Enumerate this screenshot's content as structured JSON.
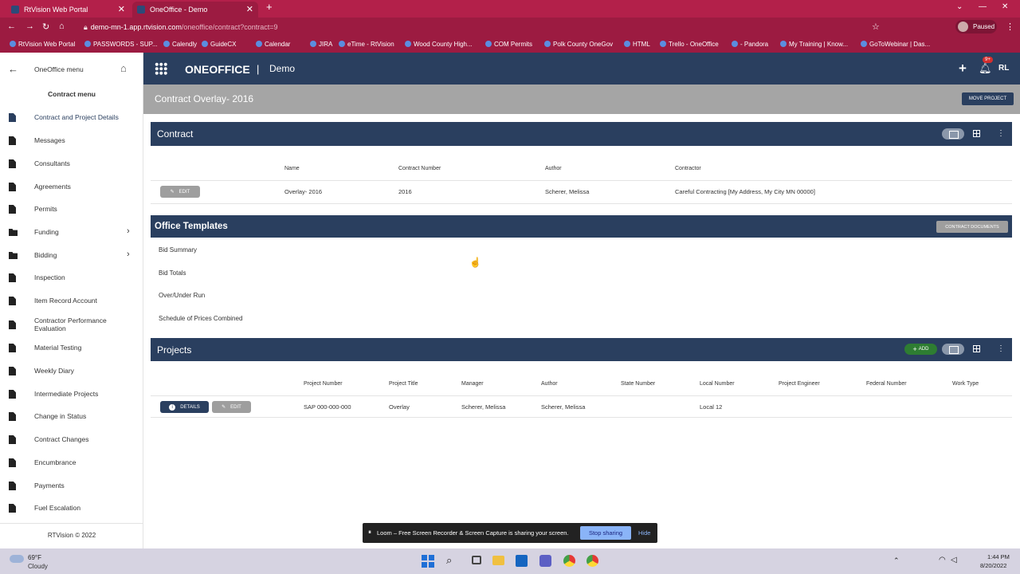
{
  "browser": {
    "tabs": [
      {
        "title": "RtVision Web Portal"
      },
      {
        "title": "OneOffice - Demo"
      }
    ],
    "url_host": "demo-mn-1.app.rtvision.com",
    "url_path": "/oneoffice/contract?contract=9",
    "profile_status": "Paused",
    "bookmarks": [
      "RtVision Web Portal",
      "PASSWORDS - SUP...",
      "Calendly",
      "GuideCX",
      "Calendar",
      "JIRA",
      "eTime - RtVision",
      "Wood County High...",
      "COM Permits",
      "Polk County OneGov",
      "HTML",
      "Trello - OneOffice",
      "- Pandora",
      "My Training | Know...",
      "GoToWebinar | Das..."
    ]
  },
  "sidebar": {
    "header": "OneOffice menu",
    "section": "Contract menu",
    "items": [
      {
        "label": "Contract and Project Details",
        "icon": "document-icon",
        "active": true
      },
      {
        "label": "Messages",
        "icon": "document-icon"
      },
      {
        "label": "Consultants",
        "icon": "document-icon"
      },
      {
        "label": "Agreements",
        "icon": "document-icon"
      },
      {
        "label": "Permits",
        "icon": "document-icon"
      },
      {
        "label": "Funding",
        "icon": "folder-icon",
        "chevron": true
      },
      {
        "label": "Bidding",
        "icon": "folder-icon",
        "chevron": true
      },
      {
        "label": "Inspection",
        "icon": "document-icon"
      },
      {
        "label": "Item Record Account",
        "icon": "document-icon"
      },
      {
        "label": "Contractor Performance Evaluation",
        "icon": "document-icon"
      },
      {
        "label": "Material Testing",
        "icon": "document-icon"
      },
      {
        "label": "Weekly Diary",
        "icon": "document-icon"
      },
      {
        "label": "Intermediate Projects",
        "icon": "document-icon"
      },
      {
        "label": "Change in Status",
        "icon": "document-icon"
      },
      {
        "label": "Contract Changes",
        "icon": "document-icon"
      },
      {
        "label": "Encumbrance",
        "icon": "document-icon"
      },
      {
        "label": "Payments",
        "icon": "document-icon"
      },
      {
        "label": "Fuel Escalation",
        "icon": "document-icon"
      }
    ],
    "footer": "RTVision © 2022"
  },
  "topbar": {
    "brand": "ONEOFFICE",
    "separator": "|",
    "context": "Demo",
    "notification_badge": "9+",
    "user_initials": "RL"
  },
  "page": {
    "title": "Contract Overlay- 2016",
    "move_project_label": "MOVE PROJECT"
  },
  "contract": {
    "title": "Contract",
    "columns": [
      "Name",
      "Contract Number",
      "Author",
      "Contractor"
    ],
    "row": {
      "name": "Overlay- 2016",
      "number": "2016",
      "author": "Scherer, Melissa",
      "contractor": "Careful Contracting [My Address, My City MN 00000]"
    },
    "edit_label": "EDIT"
  },
  "templates": {
    "title": "Office Templates",
    "button_label": "CONTRACT DOCUMENTS",
    "items": [
      "Bid Summary",
      "Bid Totals",
      "Over/Under Run",
      "Schedule of Prices Combined"
    ]
  },
  "projects": {
    "title": "Projects",
    "add_label": "ADD",
    "columns": [
      "Project Number",
      "Project Title",
      "Manager",
      "Author",
      "State Number",
      "Local Number",
      "Project Engineer",
      "Federal Number",
      "Work Type"
    ],
    "row": {
      "project_number": "SAP 000-000-000",
      "title": "Overlay",
      "manager": "Scherer, Melissa",
      "author": "Scherer, Melissa",
      "state_number": "",
      "local_number": "Local 12",
      "engineer": "",
      "federal_number": "",
      "work_type": ""
    },
    "details_label": "DETAILS",
    "edit_label": "EDIT"
  },
  "loom": {
    "message": "Loom – Free Screen Recorder & Screen Capture is sharing your screen.",
    "stop_label": "Stop sharing",
    "hide_label": "Hide"
  },
  "taskbar": {
    "temperature": "69°F",
    "weather": "Cloudy",
    "time": "1:44 PM",
    "date": "8/20/2022"
  },
  "colors": {
    "brand_navy": "#2a3f5f",
    "browser_chrome": "#9c1b41",
    "add_green": "#2e7d32"
  }
}
